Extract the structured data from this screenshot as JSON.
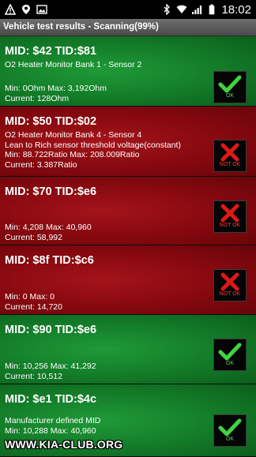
{
  "statusbar": {
    "time": "18:02",
    "icons": [
      "alert-icon",
      "location-icon",
      "image-icon",
      "bluetooth-icon",
      "wifi-icon",
      "signal-icon",
      "battery-icon"
    ]
  },
  "title": "Vehicle test results - Scanning(99%)",
  "items": [
    {
      "mid": "MID: $42 TID:$81",
      "desc1": "O2 Heater Monitor Bank 1 - Sensor 2",
      "minmax": "Min: 0Ohm  Max: 3,192Ohm",
      "current": "Current: 128Ohm",
      "status": "OK"
    },
    {
      "mid": "MID: $50 TID:$02",
      "desc1": "O2 Heater Monitor Bank 4 - Sensor 4",
      "desc2": "Lean to Rich sensor threshold voltage(constant)",
      "minmax": "Min: 88.722Ratio  Max: 208.009Ratio",
      "current": "Current: 3.387Ratio",
      "status": "NOT OK"
    },
    {
      "mid": "MID: $70 TID:$e6",
      "minmax": "Min: 4,208  Max: 40,960",
      "current": "Current: 58,992",
      "status": "NOT OK"
    },
    {
      "mid": "MID: $8f TID:$c6",
      "minmax": "Min: 0  Max: 0",
      "current": "Current: 14,720",
      "status": "NOT OK"
    },
    {
      "mid": "MID: $90 TID:$e6",
      "minmax": "Min: 10,256  Max: 41,292",
      "current": "Current: 10,512",
      "status": "OK"
    },
    {
      "mid": "MID: $e1 TID:$4c",
      "desc1": "Manufacturer defined MID",
      "minmax": "Min: 10,288  Max: 40,960",
      "status": "OK"
    }
  ],
  "watermark": "WWW.KIA-CLUB.ORG",
  "colors": {
    "pass_bg": "#137b28",
    "fail_bg": "#86090f",
    "check": "#3fd43f",
    "cross": "#e01818"
  }
}
